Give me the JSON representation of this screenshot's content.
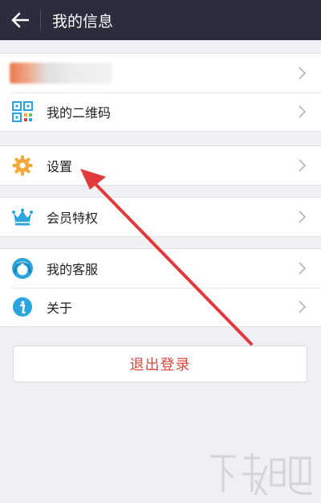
{
  "header": {
    "title": "我的信息",
    "back_icon": "arrow-left-icon",
    "bg_color": "#2a2d3c"
  },
  "groups": {
    "account": {
      "qr_label": "我的二维码"
    },
    "settings": {
      "label": "设置"
    },
    "membership": {
      "label": "会员特权"
    },
    "support": {
      "service_label": "我的客服",
      "about_label": "关于"
    }
  },
  "logout": {
    "label": "退出登录",
    "color": "#e0443a"
  },
  "icons": {
    "qr": "qr-code-icon",
    "settings": "gear-icon",
    "membership": "crown-icon",
    "service": "customer-service-icon",
    "about": "info-icon"
  },
  "colors": {
    "accent_blue": "#2aa5e0",
    "gear_orange": "#f3a93a",
    "annotation_red": "#e23a3a",
    "background": "#efeff4"
  }
}
